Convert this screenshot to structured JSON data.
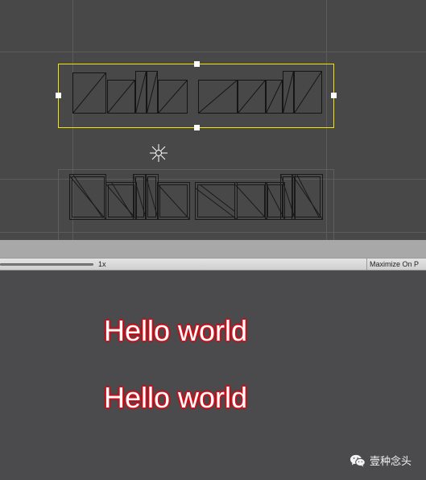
{
  "game_toolbar": {
    "scale_label": "1x",
    "maximize_label": "Maximize On P"
  },
  "game_view": {
    "text_line_1": "Hello world",
    "text_line_2": "Hello world"
  },
  "watermark": {
    "text": "壹种念头",
    "icon": "wechat-icon"
  },
  "colors": {
    "scene_background": "#484848",
    "grid": "#5a5a5a",
    "selection_rect": "#f3e600",
    "handle": "#ffffff",
    "game_background": "#4b4b4d",
    "text_fill": "#ffffff",
    "text_outline": "#d9131e"
  }
}
